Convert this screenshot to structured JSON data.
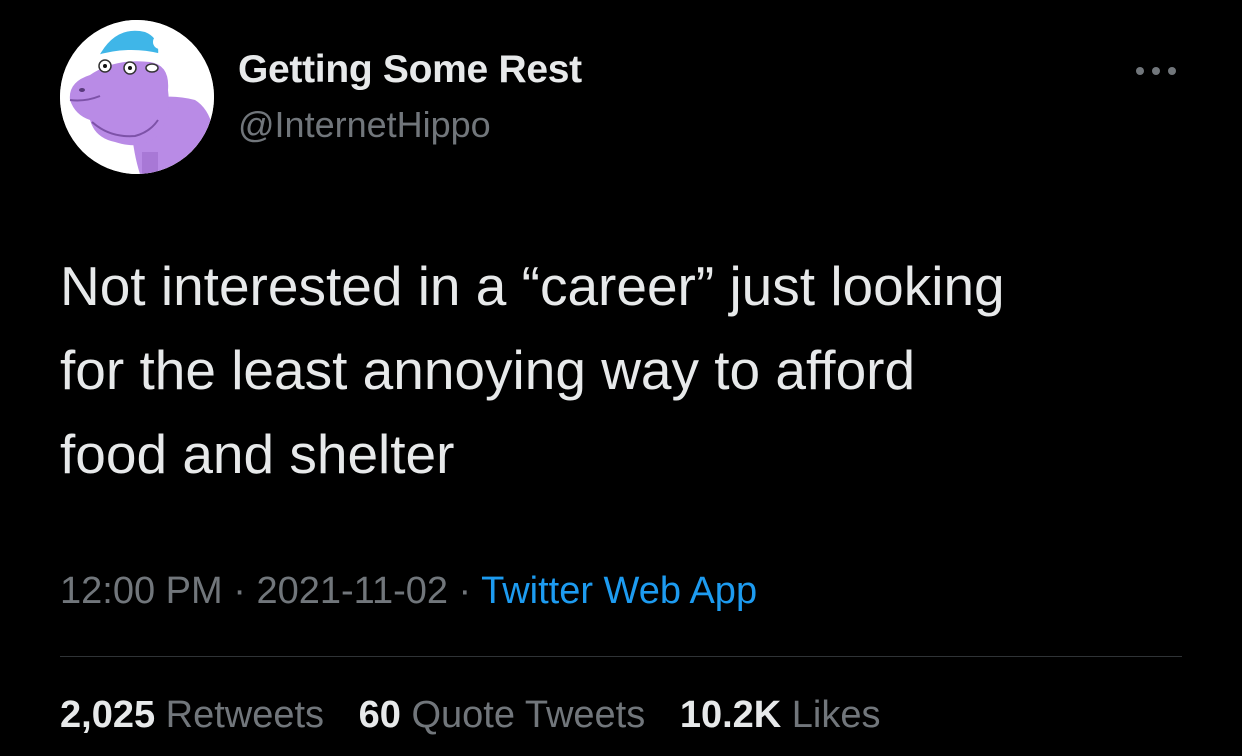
{
  "author": {
    "display_name": "Getting Some Rest",
    "handle": "@InternetHippo",
    "avatar_icon": "hippo-with-sleep-cap-icon"
  },
  "header": {
    "more_icon": "more-options-icon"
  },
  "tweet": {
    "text": "Not interested in a “career” just looking\nfor the least annoying way to afford\nfood and shelter",
    "time": "12:00 PM",
    "separator": " · ",
    "date": "2021-11-02",
    "source": "Twitter Web App"
  },
  "stats": {
    "retweets_count": "2,025",
    "retweets_label": "Retweets",
    "quotes_count": "60",
    "quotes_label": "Quote Tweets",
    "likes_count": "10.2K",
    "likes_label": "Likes"
  },
  "colors": {
    "background": "#000000",
    "text_primary": "#e7e9ea",
    "text_secondary": "#71767b",
    "link": "#1d9bf0",
    "divider": "#2f3336"
  }
}
